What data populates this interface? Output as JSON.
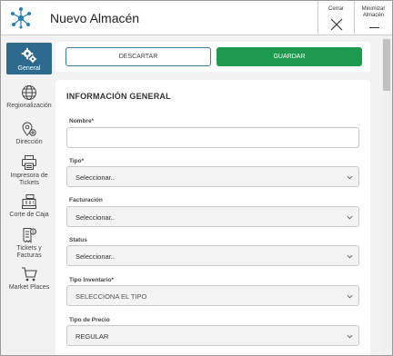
{
  "window": {
    "title": "Nuevo Almacén",
    "close_label": "Cerrar",
    "minimize_label_line1": "Minimizar",
    "minimize_label_line2": "Almacén",
    "logo_icon": "network-hub-icon"
  },
  "sidebar": {
    "active_color": "#2d6a8e",
    "items": [
      {
        "label": "General",
        "icon": "gears-icon",
        "active": true
      },
      {
        "label": "Regionalización",
        "icon": "globe-icon",
        "active": false
      },
      {
        "label": "Dirección",
        "icon": "location-gear-icon",
        "active": false
      },
      {
        "label_line1": "Impresora de",
        "label_line2": "Tickets",
        "icon": "printer-icon",
        "active": false
      },
      {
        "label": "Corte de Caja",
        "icon": "cash-register-icon",
        "active": false
      },
      {
        "label_line1": "Tickets y",
        "label_line2": "Facturas",
        "icon": "receipt-icon",
        "active": false
      },
      {
        "label": "Market Places",
        "icon": "cart-icon",
        "active": false
      }
    ]
  },
  "actions": {
    "discard_label": "DESCARTAR",
    "save_label": "GUARDAR",
    "save_color": "#1e9a4e"
  },
  "form": {
    "section_title": "INFORMACIÓN GENERAL",
    "fields": [
      {
        "label": "Nombre*",
        "value": ""
      },
      {
        "label": "Tipo*",
        "value": "Seleccionar.."
      },
      {
        "label": "Facturación",
        "value": "Seleccionar.."
      },
      {
        "label": "Status",
        "value": "Seleccionar.."
      },
      {
        "label": "Tipo Inventario*",
        "value": "SELECCIONA EL TIPO"
      },
      {
        "label": "Tipo de Precio",
        "value": "REGULAR"
      }
    ]
  }
}
